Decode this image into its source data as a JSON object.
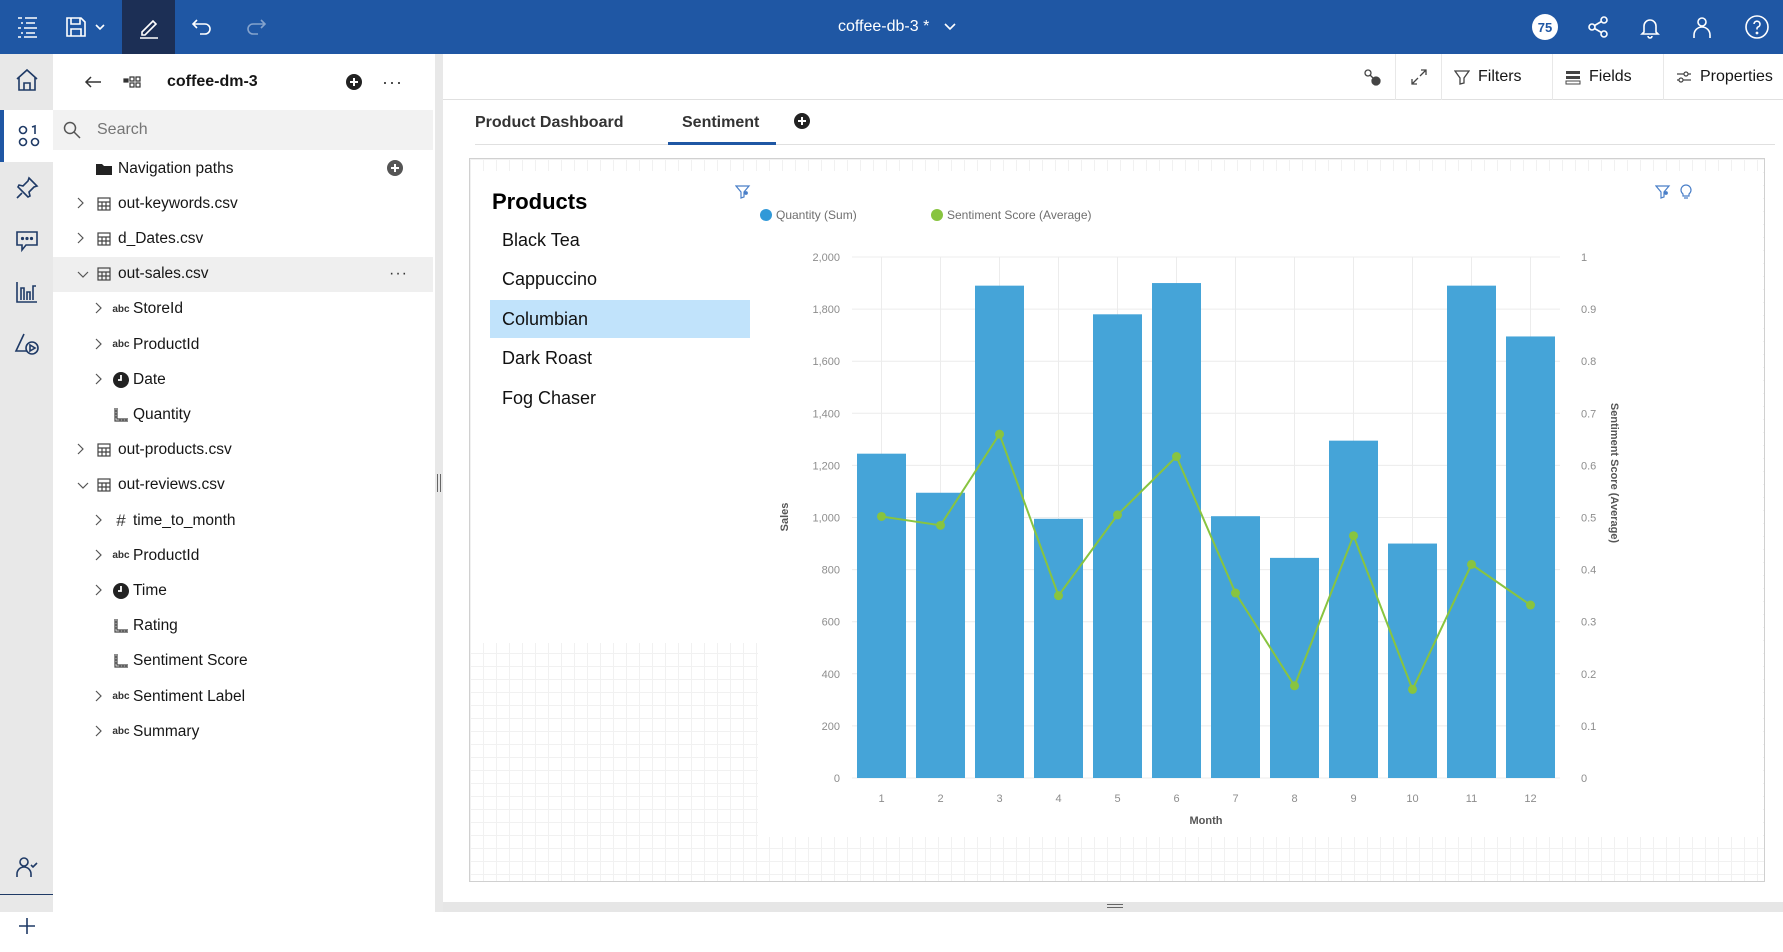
{
  "topbar": {
    "title": "coffee-db-3 *",
    "notification_count": "75",
    "colors": {
      "bar": "#1f57a4",
      "edit_active": "#1c2f55"
    }
  },
  "rail": {
    "items": [
      "home-icon",
      "data-icon",
      "pin-icon",
      "chat-icon",
      "chart-icon",
      "shapes-icon",
      "user-check-icon",
      "add-icon"
    ]
  },
  "source_panel": {
    "title": "coffee-dm-3",
    "search_placeholder": "Search",
    "tree": [
      {
        "label": "Navigation paths",
        "icon": "folder-icon",
        "level": 0,
        "expander": "none"
      },
      {
        "label": "out-keywords.csv",
        "icon": "table-icon",
        "level": 0,
        "expander": "collapsed"
      },
      {
        "label": "d_Dates.csv",
        "icon": "table-icon",
        "level": 0,
        "expander": "collapsed"
      },
      {
        "label": "out-sales.csv",
        "icon": "table-icon",
        "level": 0,
        "expander": "expanded",
        "selected": true
      },
      {
        "label": "StoreId",
        "icon": "abc",
        "level": 1,
        "expander": "collapsed"
      },
      {
        "label": "ProductId",
        "icon": "abc",
        "level": 1,
        "expander": "collapsed"
      },
      {
        "label": "Date",
        "icon": "clock-icon",
        "level": 1,
        "expander": "collapsed"
      },
      {
        "label": "Quantity",
        "icon": "measure-icon",
        "level": 1,
        "expander": "none"
      },
      {
        "label": "out-products.csv",
        "icon": "table-icon",
        "level": 0,
        "expander": "collapsed"
      },
      {
        "label": "out-reviews.csv",
        "icon": "table-icon",
        "level": 0,
        "expander": "expanded"
      },
      {
        "label": "time_to_month",
        "icon": "#",
        "level": 1,
        "expander": "collapsed"
      },
      {
        "label": "ProductId",
        "icon": "abc",
        "level": 1,
        "expander": "collapsed"
      },
      {
        "label": "Time",
        "icon": "clock-icon",
        "level": 1,
        "expander": "collapsed"
      },
      {
        "label": "Rating",
        "icon": "measure-icon",
        "level": 1,
        "expander": "none"
      },
      {
        "label": "Sentiment Score",
        "icon": "measure-icon",
        "level": 1,
        "expander": "none"
      },
      {
        "label": "Sentiment Label",
        "icon": "abc",
        "level": 1,
        "expander": "collapsed"
      },
      {
        "label": "Summary",
        "icon": "abc",
        "level": 1,
        "expander": "collapsed"
      }
    ]
  },
  "toolbar": {
    "filters_label": "Filters",
    "fields_label": "Fields",
    "properties_label": "Properties"
  },
  "tabs": [
    {
      "label": "Product Dashboard",
      "active": false
    },
    {
      "label": "Sentiment",
      "active": true
    }
  ],
  "products_widget": {
    "title": "Products",
    "items": [
      "Black Tea",
      "Cappuccino",
      "Columbian",
      "Dark Roast",
      "Fog Chaser"
    ],
    "selected": "Columbian",
    "selected_color": "#c1e3fb"
  },
  "chart_data": {
    "type": "bar",
    "title": "",
    "xlabel": "Month",
    "ylabel": "Sales",
    "y2label": "Sentiment Score (Average)",
    "categories": [
      "1",
      "2",
      "3",
      "4",
      "5",
      "6",
      "7",
      "8",
      "9",
      "10",
      "11",
      "12"
    ],
    "ylim": [
      0,
      2000
    ],
    "yticks": [
      "0",
      "200",
      "400",
      "600",
      "800",
      "1,000",
      "1,200",
      "1,400",
      "1,600",
      "1,800",
      "2,000"
    ],
    "y2lim": [
      0,
      1
    ],
    "y2ticks": [
      "0",
      "0.1",
      "0.2",
      "0.3",
      "0.4",
      "0.5",
      "0.6",
      "0.7",
      "0.8",
      "0.9",
      "1"
    ],
    "grid": true,
    "legend_position": "top-left",
    "series": [
      {
        "name": "Quantity (Sum)",
        "type": "bar",
        "axis": "left",
        "color": "#45a4d8",
        "values": [
          1245,
          1095,
          1890,
          995,
          1780,
          1900,
          1005,
          845,
          1295,
          900,
          1890,
          1695
        ]
      },
      {
        "name": "Sentiment Score (Average)",
        "type": "line",
        "axis": "right",
        "color": "#88c440",
        "values": [
          0.502,
          0.485,
          0.66,
          0.35,
          0.505,
          0.617,
          0.355,
          0.177,
          0.465,
          0.17,
          0.41,
          0.332
        ]
      }
    ]
  }
}
